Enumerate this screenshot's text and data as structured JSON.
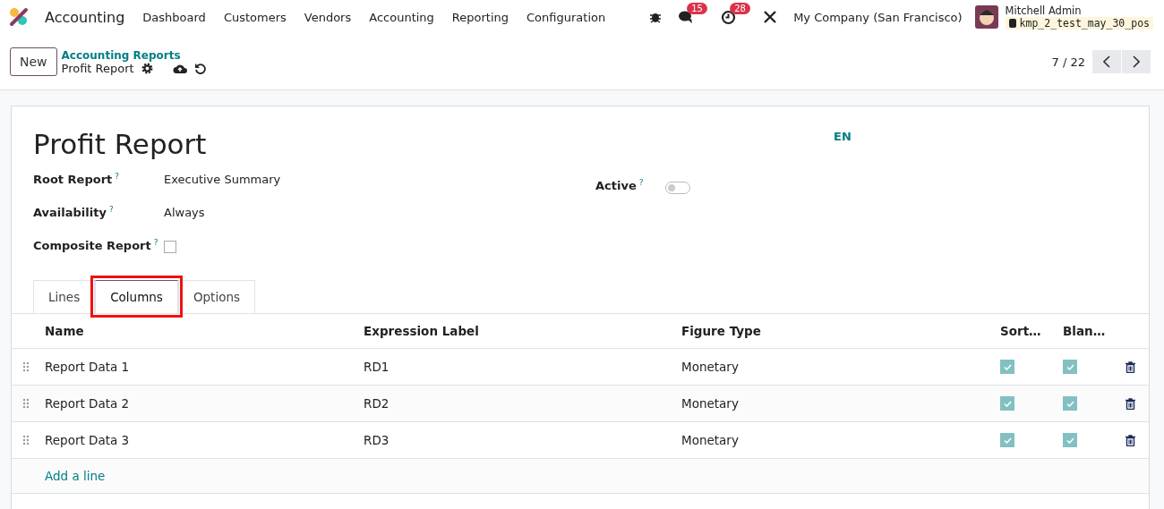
{
  "navbar": {
    "app": "Accounting",
    "menu": [
      "Dashboard",
      "Customers",
      "Vendors",
      "Accounting",
      "Reporting",
      "Configuration"
    ],
    "messages_badge": "15",
    "activities_badge": "28",
    "company": "My Company (San Francisco)",
    "user": "Mitchell Admin",
    "database": "kmp_2_test_may_30_pos"
  },
  "control_panel": {
    "new_button": "New",
    "breadcrumb": "Accounting Reports",
    "current": "Profit Report",
    "pager": "7 / 22"
  },
  "form": {
    "title": "Profit Report",
    "language": "EN",
    "fields": [
      {
        "kind": "text",
        "label": "Root Report",
        "help": "?",
        "value": "Executive Summary"
      },
      {
        "kind": "text",
        "label": "Availability",
        "help": "?",
        "value": "Always"
      },
      {
        "kind": "checkbox",
        "label": "Composite Report",
        "help": "?",
        "checked": false
      }
    ],
    "active": {
      "label": "Active",
      "help": "?",
      "on": false
    },
    "tabs": [
      {
        "label": "Lines",
        "selected": false,
        "highlighted": false
      },
      {
        "label": "Columns",
        "selected": true,
        "highlighted": true
      },
      {
        "label": "Options",
        "selected": false,
        "highlighted": false
      }
    ],
    "table": {
      "columns": [
        "Name",
        "Expression Label",
        "Figure Type",
        "Sort…",
        "Blan…"
      ],
      "rows": [
        {
          "name": "Report Data 1",
          "label": "RD1",
          "figure": "Monetary",
          "sortable": true,
          "blank_if_zero": true
        },
        {
          "name": "Report Data 2",
          "label": "RD2",
          "figure": "Monetary",
          "sortable": true,
          "blank_if_zero": true
        },
        {
          "name": "Report Data 3",
          "label": "RD3",
          "figure": "Monetary",
          "sortable": true,
          "blank_if_zero": true
        }
      ],
      "add_line": "Add a line"
    }
  }
}
